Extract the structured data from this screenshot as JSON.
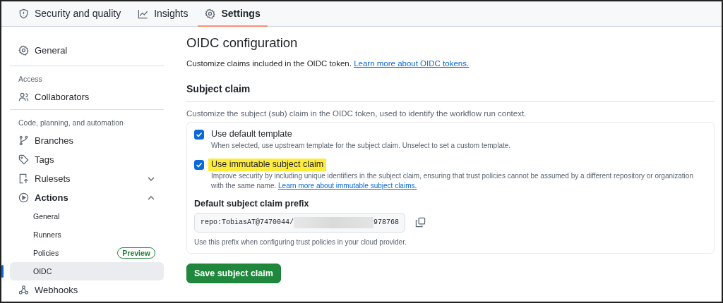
{
  "tabs": [
    {
      "label": "Security and quality",
      "selected": false
    },
    {
      "label": "Insights",
      "selected": false
    },
    {
      "label": "Settings",
      "selected": true
    }
  ],
  "sidebar": {
    "sections": [
      {
        "items": [
          {
            "label": "General",
            "selected": false
          }
        ]
      },
      {
        "heading": "Access",
        "items": [
          {
            "label": "Collaborators",
            "selected": false
          }
        ]
      },
      {
        "heading": "Code, planning, and automation",
        "items": [
          {
            "label": "Branches",
            "selected": false
          },
          {
            "label": "Tags",
            "selected": false
          },
          {
            "label": "Rulesets",
            "selected": false,
            "expanded": false
          },
          {
            "label": "Actions",
            "selected": false,
            "expanded": true,
            "children": [
              {
                "label": "General",
                "selected": false
              },
              {
                "label": "Runners",
                "selected": false
              },
              {
                "label": "Policies",
                "selected": false,
                "badge": "Preview"
              },
              {
                "label": "OIDC",
                "selected": true
              }
            ]
          },
          {
            "label": "Webhooks",
            "selected": false
          }
        ]
      }
    ]
  },
  "main": {
    "title": "OIDC configuration",
    "intro": "Customize claims included in the OIDC token.",
    "intro_link": "Learn more about OIDC tokens.",
    "section_title": "Subject claim",
    "section_desc": "Customize the subject (sub) claim in the OIDC token, used to identify the workflow run context.",
    "options": [
      {
        "label": "Use default template",
        "checked": true,
        "highlighted": false,
        "desc": "When selected, use upstream template for the subject claim. Unselect to set a custom template."
      },
      {
        "label": "Use immutable subject claim",
        "checked": true,
        "highlighted": true,
        "desc": "Improve security by including unique identifiers in the subject claim, ensuring that trust policies cannot be assumed by a different repository or organization with the same name.",
        "link": "Learn more about immutable subject claims."
      }
    ],
    "prefix_label": "Default subject claim prefix",
    "prefix_start": "repo:TobiasAT@7470044/",
    "prefix_end": "978768",
    "prefix_hint": "Use this prefix when configuring trust policies in your cloud provider.",
    "save_button": "Save subject claim"
  }
}
